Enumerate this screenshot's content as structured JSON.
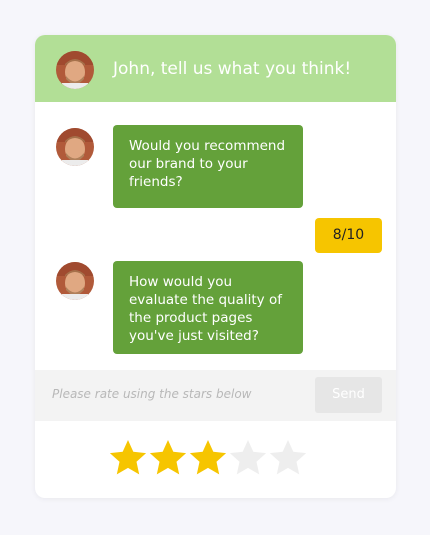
{
  "header": {
    "title": "John, tell us what you think!"
  },
  "conversation": {
    "questions": [
      "Would you recommend our brand to your friends?",
      "How would you evaluate the quality of the product pages you've just visited?"
    ],
    "answers": [
      "8/10"
    ]
  },
  "input": {
    "placeholder": "Please rate using the stars below",
    "send_label": "Send"
  },
  "rating": {
    "value": 3,
    "max": 5
  },
  "colors": {
    "header_bg": "#b2df96",
    "bubble_bg": "#64a13a",
    "answer_bg": "#f6c500",
    "star_filled": "#f6c500",
    "star_empty": "#eeeeee"
  }
}
